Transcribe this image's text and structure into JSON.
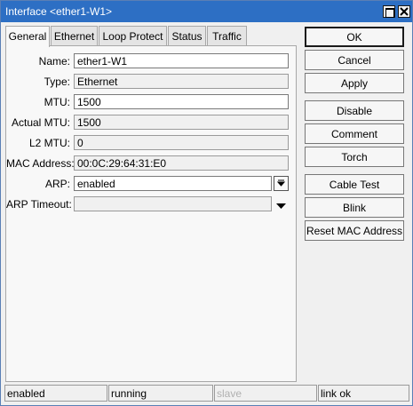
{
  "window": {
    "title": "Interface <ether1-W1>"
  },
  "tabs": [
    {
      "label": "General",
      "active": true
    },
    {
      "label": "Ethernet",
      "active": false
    },
    {
      "label": "Loop Protect",
      "active": false
    },
    {
      "label": "Status",
      "active": false
    },
    {
      "label": "Traffic",
      "active": false
    }
  ],
  "form": {
    "name": {
      "label": "Name:",
      "value": "ether1-W1"
    },
    "type": {
      "label": "Type:",
      "value": "Ethernet"
    },
    "mtu": {
      "label": "MTU:",
      "value": "1500"
    },
    "actual_mtu": {
      "label": "Actual MTU:",
      "value": "1500"
    },
    "l2_mtu": {
      "label": "L2 MTU:",
      "value": "0"
    },
    "mac_address": {
      "label": "MAC Address:",
      "value": "00:0C:29:64:31:E0"
    },
    "arp": {
      "label": "ARP:",
      "value": "enabled"
    },
    "arp_timeout": {
      "label": "ARP Timeout:",
      "value": ""
    }
  },
  "buttons": {
    "ok": "OK",
    "cancel": "Cancel",
    "apply": "Apply",
    "disable": "Disable",
    "comment": "Comment",
    "torch": "Torch",
    "cable_test": "Cable Test",
    "blink": "Blink",
    "reset_mac": "Reset MAC Address"
  },
  "status_bar": {
    "state": "enabled",
    "running": "running",
    "slave": "slave",
    "link": "link ok"
  },
  "icons": {
    "maximize": "maximize-icon",
    "close": "close-icon",
    "dropdown": "chevron-down-icon"
  },
  "colors": {
    "titlebar": "#2d6fc4",
    "background": "#f0f0f0",
    "panel": "#f8f8f8"
  }
}
